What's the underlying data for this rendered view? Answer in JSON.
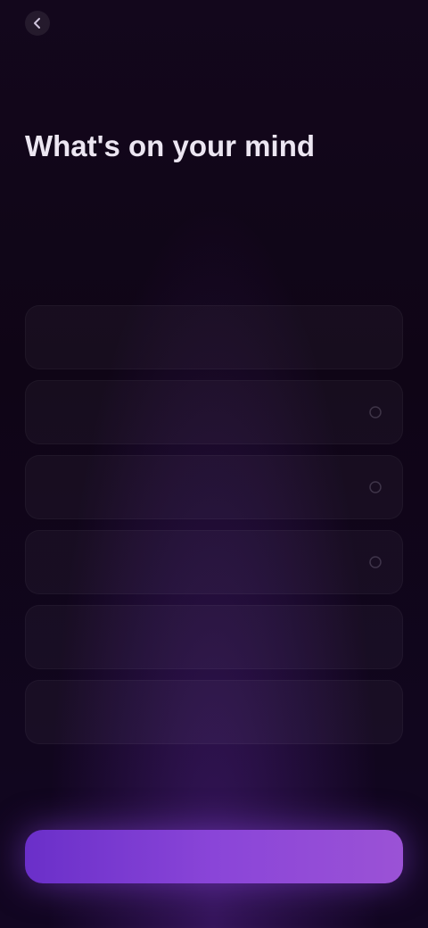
{
  "topbar": {
    "back_icon": "chevron-left-icon",
    "app_name": ""
  },
  "header": {
    "progress_label": "",
    "skip_label": ""
  },
  "heading": {
    "title_line1": "What's on your mind",
    "title_accent": "",
    "subtitle": ""
  },
  "options": [
    {
      "label": "",
      "icon": "radio-icon"
    },
    {
      "label": "",
      "icon": "radio-icon"
    },
    {
      "label": "",
      "icon": "radio-icon"
    },
    {
      "label": "",
      "icon": "radio-icon"
    },
    {
      "label": "",
      "icon": "radio-icon"
    },
    {
      "label": "",
      "icon": "radio-icon"
    }
  ],
  "footer": {
    "continue_label": ""
  },
  "colors": {
    "background": "#0f0516",
    "accent": "#8a5ac8",
    "button_start": "#6a2fc9",
    "button_end": "#9b52d6"
  }
}
